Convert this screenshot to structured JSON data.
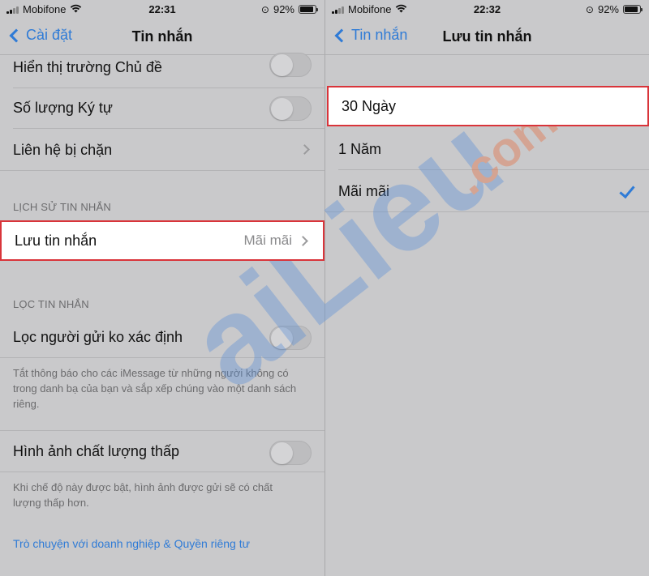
{
  "left": {
    "status": {
      "carrier": "Mobifone",
      "time": "22:31",
      "battery": "92%"
    },
    "nav": {
      "back_label": "Cài đặt",
      "title": "Tin nhắn"
    },
    "rows_top": [
      {
        "label": "Hiển thị trường Chủ đề"
      },
      {
        "label": "Số lượng Ký tự"
      },
      {
        "label": "Liên hệ bị chặn"
      }
    ],
    "history_header": "LỊCH SỬ TIN NHẮN",
    "keep_messages": {
      "label": "Lưu tin nhắn",
      "value": "Mãi mãi"
    },
    "filter_header": "LỌC TIN NHẮN",
    "filter_unknown": {
      "label": "Lọc người gửi ko xác định"
    },
    "filter_note": "Tắt thông báo cho các iMessage từ những người không có trong danh bạ của bạn và sắp xếp chúng vào một danh sách riêng.",
    "low_quality": {
      "label": "Hình ảnh chất lượng thấp"
    },
    "low_quality_note": "Khi chế độ này được bật, hình ảnh được gửi sẽ có chất lượng thấp hơn.",
    "privacy_link": "Trò chuyện với doanh nghiệp & Quyền riêng tư"
  },
  "right": {
    "status": {
      "carrier": "Mobifone",
      "time": "22:32",
      "battery": "92%"
    },
    "nav": {
      "back_label": "Tin nhắn",
      "title": "Lưu tin nhắn"
    },
    "options": [
      {
        "label": "30 Ngày",
        "selected": false,
        "highlighted": true
      },
      {
        "label": "1 Năm",
        "selected": false
      },
      {
        "label": "Mãi mãi",
        "selected": true
      }
    ]
  },
  "watermark": {
    "text_main": "aiLieu",
    "text_suffix": ".com"
  },
  "colors": {
    "accent": "#2f7bd6",
    "highlight_border": "#d9343a",
    "dim_bg": "#c9c9cb"
  }
}
